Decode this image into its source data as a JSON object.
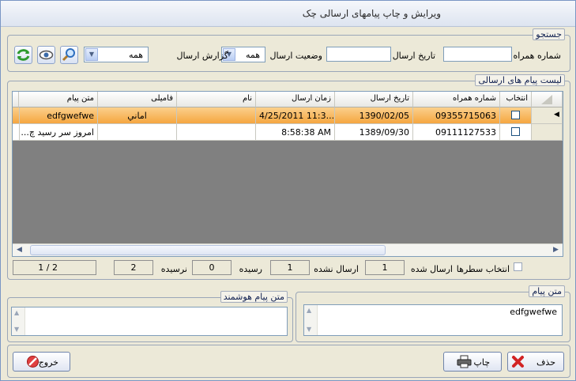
{
  "window": {
    "title": "ویرایش و چاپ پیامهای ارسالی چک"
  },
  "search": {
    "group_label": "جستجو",
    "phone_label": "شماره همراه",
    "phone_value": "",
    "date_label": "تاریخ ارسال",
    "date_value": "",
    "status_label": "وضعیت ارسال",
    "status_value": "همه",
    "report_label": "گزارش ارسال",
    "report_value": "همه",
    "icons": [
      "search-icon",
      "view-icon",
      "refresh-icon"
    ]
  },
  "list": {
    "group_label": "لیست پیام های ارسالی",
    "columns": {
      "select": "انتخاب",
      "phone": "شماره همراه",
      "date": "تاریخ ارسال",
      "time": "زمان ارسال",
      "name": "نام",
      "family": "فامیلی",
      "message": "متن پیام"
    },
    "rows": [
      {
        "phone": "09355715063",
        "date": "1390/02/05",
        "time": "4/25/2011 11:3...",
        "name": "",
        "family": "اماني",
        "message": "edfgwefwe",
        "selected": true
      },
      {
        "phone": "09111127533",
        "date": "1389/09/30",
        "time": "8:58:38 AM",
        "name": "",
        "family": "",
        "message": "امروز سر رسید چ...",
        "selected": false
      }
    ]
  },
  "stats": {
    "select_rows_label": "انتخاب سطرها",
    "sent_label": "ارسال شده",
    "sent_value": "1",
    "not_sent_label": "ارسال نشده",
    "not_sent_value": "1",
    "delivered_label": "رسیده",
    "delivered_value": "0",
    "not_delivered_label": "نرسیده",
    "not_delivered_value": "2",
    "page_value": "1 / 2"
  },
  "message": {
    "group_label": "متن پیام",
    "text": "edfgwefwe"
  },
  "smart_message": {
    "group_label": "متن پیام هوشمند",
    "text": ""
  },
  "buttons": {
    "delete": "حذف",
    "print": "چاپ",
    "exit": "خروج"
  },
  "colors": {
    "selected_row": "#f5a640",
    "accent": "#7f9db9"
  }
}
